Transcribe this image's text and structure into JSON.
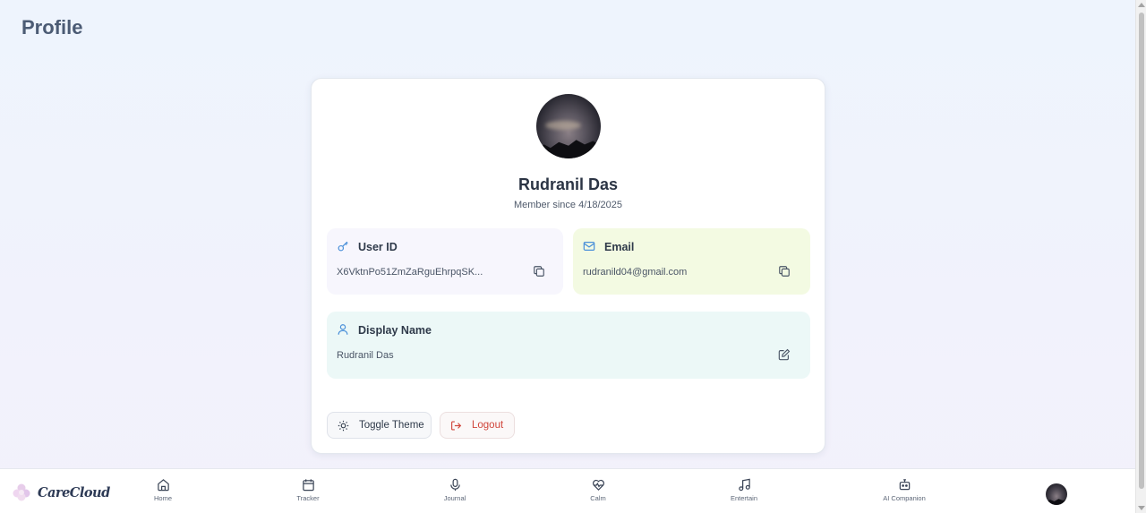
{
  "page": {
    "title": "Profile"
  },
  "profile": {
    "name": "Rudranil Das",
    "member_since": "Member since 4/18/2025",
    "user_id": {
      "title": "User ID",
      "value": "X6VktnPo51ZmZaRguEhrpqSK..."
    },
    "email": {
      "title": "Email",
      "value": "rudranild04@gmail.com"
    },
    "display_name": {
      "title": "Display Name",
      "value": "Rudranil Das"
    }
  },
  "actions": {
    "toggle_theme": "Toggle Theme",
    "logout": "Logout"
  },
  "nav": {
    "brand": "CareCloud",
    "items": [
      {
        "label": "Home",
        "icon": "home-icon"
      },
      {
        "label": "Tracker",
        "icon": "calendar-icon"
      },
      {
        "label": "Journal",
        "icon": "microphone-icon"
      },
      {
        "label": "Calm",
        "icon": "heart-pulse-icon"
      },
      {
        "label": "Entertain",
        "icon": "music-icon"
      },
      {
        "label": "AI Companion",
        "icon": "robot-icon"
      }
    ]
  },
  "colors": {
    "accent": "#4a90d9",
    "logout": "#d0453b",
    "userid_bg": "#f7f6fd",
    "email_bg": "#f3fae2",
    "display_bg": "#ecf8f7"
  }
}
